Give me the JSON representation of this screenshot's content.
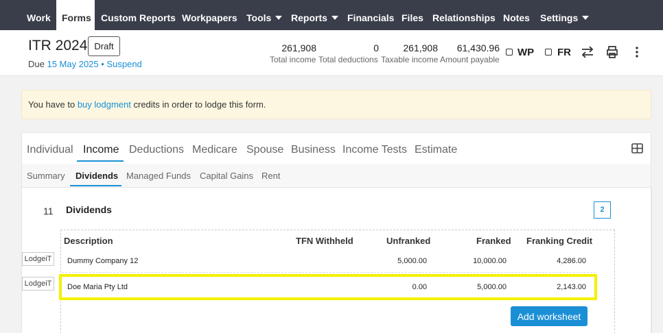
{
  "nav": {
    "items": [
      {
        "label": "Work"
      },
      {
        "label": "Forms"
      },
      {
        "label": "Custom Reports"
      },
      {
        "label": "Workpapers"
      },
      {
        "label": "Tools"
      },
      {
        "label": "Reports"
      },
      {
        "label": "Financials"
      },
      {
        "label": "Files"
      },
      {
        "label": "Relationships"
      },
      {
        "label": "Notes"
      },
      {
        "label": "Settings"
      }
    ]
  },
  "header": {
    "title": "ITR 2024",
    "status": "Draft",
    "due_prefix": "Due",
    "due_date": "15 May 2025",
    "separator": "•",
    "suspend_label": "Suspend",
    "summary": [
      {
        "value": "261,908",
        "label": "Total income"
      },
      {
        "value": "0",
        "label": "Total deductions"
      },
      {
        "value": "261,908",
        "label": "Taxable income"
      },
      {
        "value": "61,430.96",
        "label": "Amount payable"
      }
    ],
    "checkboxes": [
      {
        "label": "WP"
      },
      {
        "label": "FR"
      }
    ],
    "icons": [
      "swap-icon",
      "print-icon",
      "more-vertical-icon"
    ]
  },
  "alert": {
    "prefix": "You have to ",
    "link": "buy lodgment",
    "suffix": " credits in order to lodge this form."
  },
  "tabs": [
    {
      "label": "Individual"
    },
    {
      "label": "Income"
    },
    {
      "label": "Deductions"
    },
    {
      "label": "Medicare"
    },
    {
      "label": "Spouse"
    },
    {
      "label": "Business"
    },
    {
      "label": "Income Tests"
    },
    {
      "label": "Estimate"
    }
  ],
  "subtabs": [
    {
      "label": "Summary"
    },
    {
      "label": "Dividends"
    },
    {
      "label": "Managed Funds"
    },
    {
      "label": "Capital Gains"
    },
    {
      "label": "Rent"
    }
  ],
  "section": {
    "number": "11",
    "title": "Dividends",
    "count": "2",
    "columns": [
      "Description",
      "TFN Withheld",
      "Unfranked",
      "Franked",
      "Franking Credit"
    ],
    "rows": [
      {
        "tag": "LodgeiT",
        "description": "Dummy Company 12",
        "tfn": "",
        "unfranked": "5,000.00",
        "franked": "10,000.00",
        "credit": "4,286.00"
      },
      {
        "tag": "LodgeiT",
        "description": "Doe Maria Pty Ltd",
        "tfn": "",
        "unfranked": "0.00",
        "franked": "5,000.00",
        "credit": "2,143.00"
      }
    ],
    "add_button": "Add worksheet"
  },
  "colors": {
    "nav_bg": "#3a3d4a",
    "accent": "#1a8fd6",
    "alert_bg": "#fdf7e1",
    "highlight": "#f5f000"
  }
}
